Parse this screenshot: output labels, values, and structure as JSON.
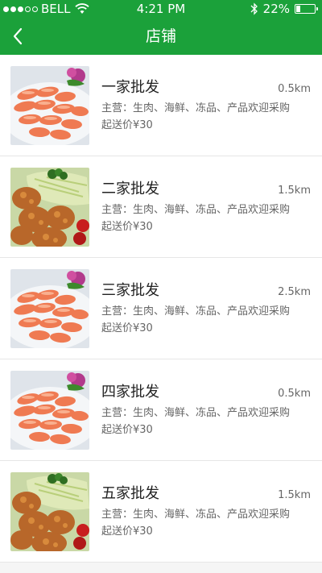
{
  "status_bar": {
    "carrier": "BELL",
    "time": "4:21 PM",
    "battery": "22%",
    "battery_level": 0.22
  },
  "header": {
    "title": "店铺",
    "back_icon": "chevron-left-icon",
    "background_color": "#1ba13a"
  },
  "shops": [
    {
      "name": "一家批发",
      "distance": "0.5km",
      "main_business": "主营：生肉、海鲜、冻品、产品欢迎采购",
      "min_order": "起送价¥30",
      "image": "shrimp-plate"
    },
    {
      "name": "二家批发",
      "distance": "1.5km",
      "main_business": "主营：生肉、海鲜、冻品、产品欢迎采购",
      "min_order": "起送价¥30",
      "image": "fried-chicken"
    },
    {
      "name": "三家批发",
      "distance": "2.5km",
      "main_business": "主营：生肉、海鲜、冻品、产品欢迎采购",
      "min_order": "起送价¥30",
      "image": "shrimp-plate"
    },
    {
      "name": "四家批发",
      "distance": "0.5km",
      "main_business": "主营：生肉、海鲜、冻品、产品欢迎采购",
      "min_order": "起送价¥30",
      "image": "shrimp-plate"
    },
    {
      "name": "五家批发",
      "distance": "1.5km",
      "main_business": "主营：生肉、海鲜、冻品、产品欢迎采购",
      "min_order": "起送价¥30",
      "image": "fried-chicken"
    }
  ]
}
